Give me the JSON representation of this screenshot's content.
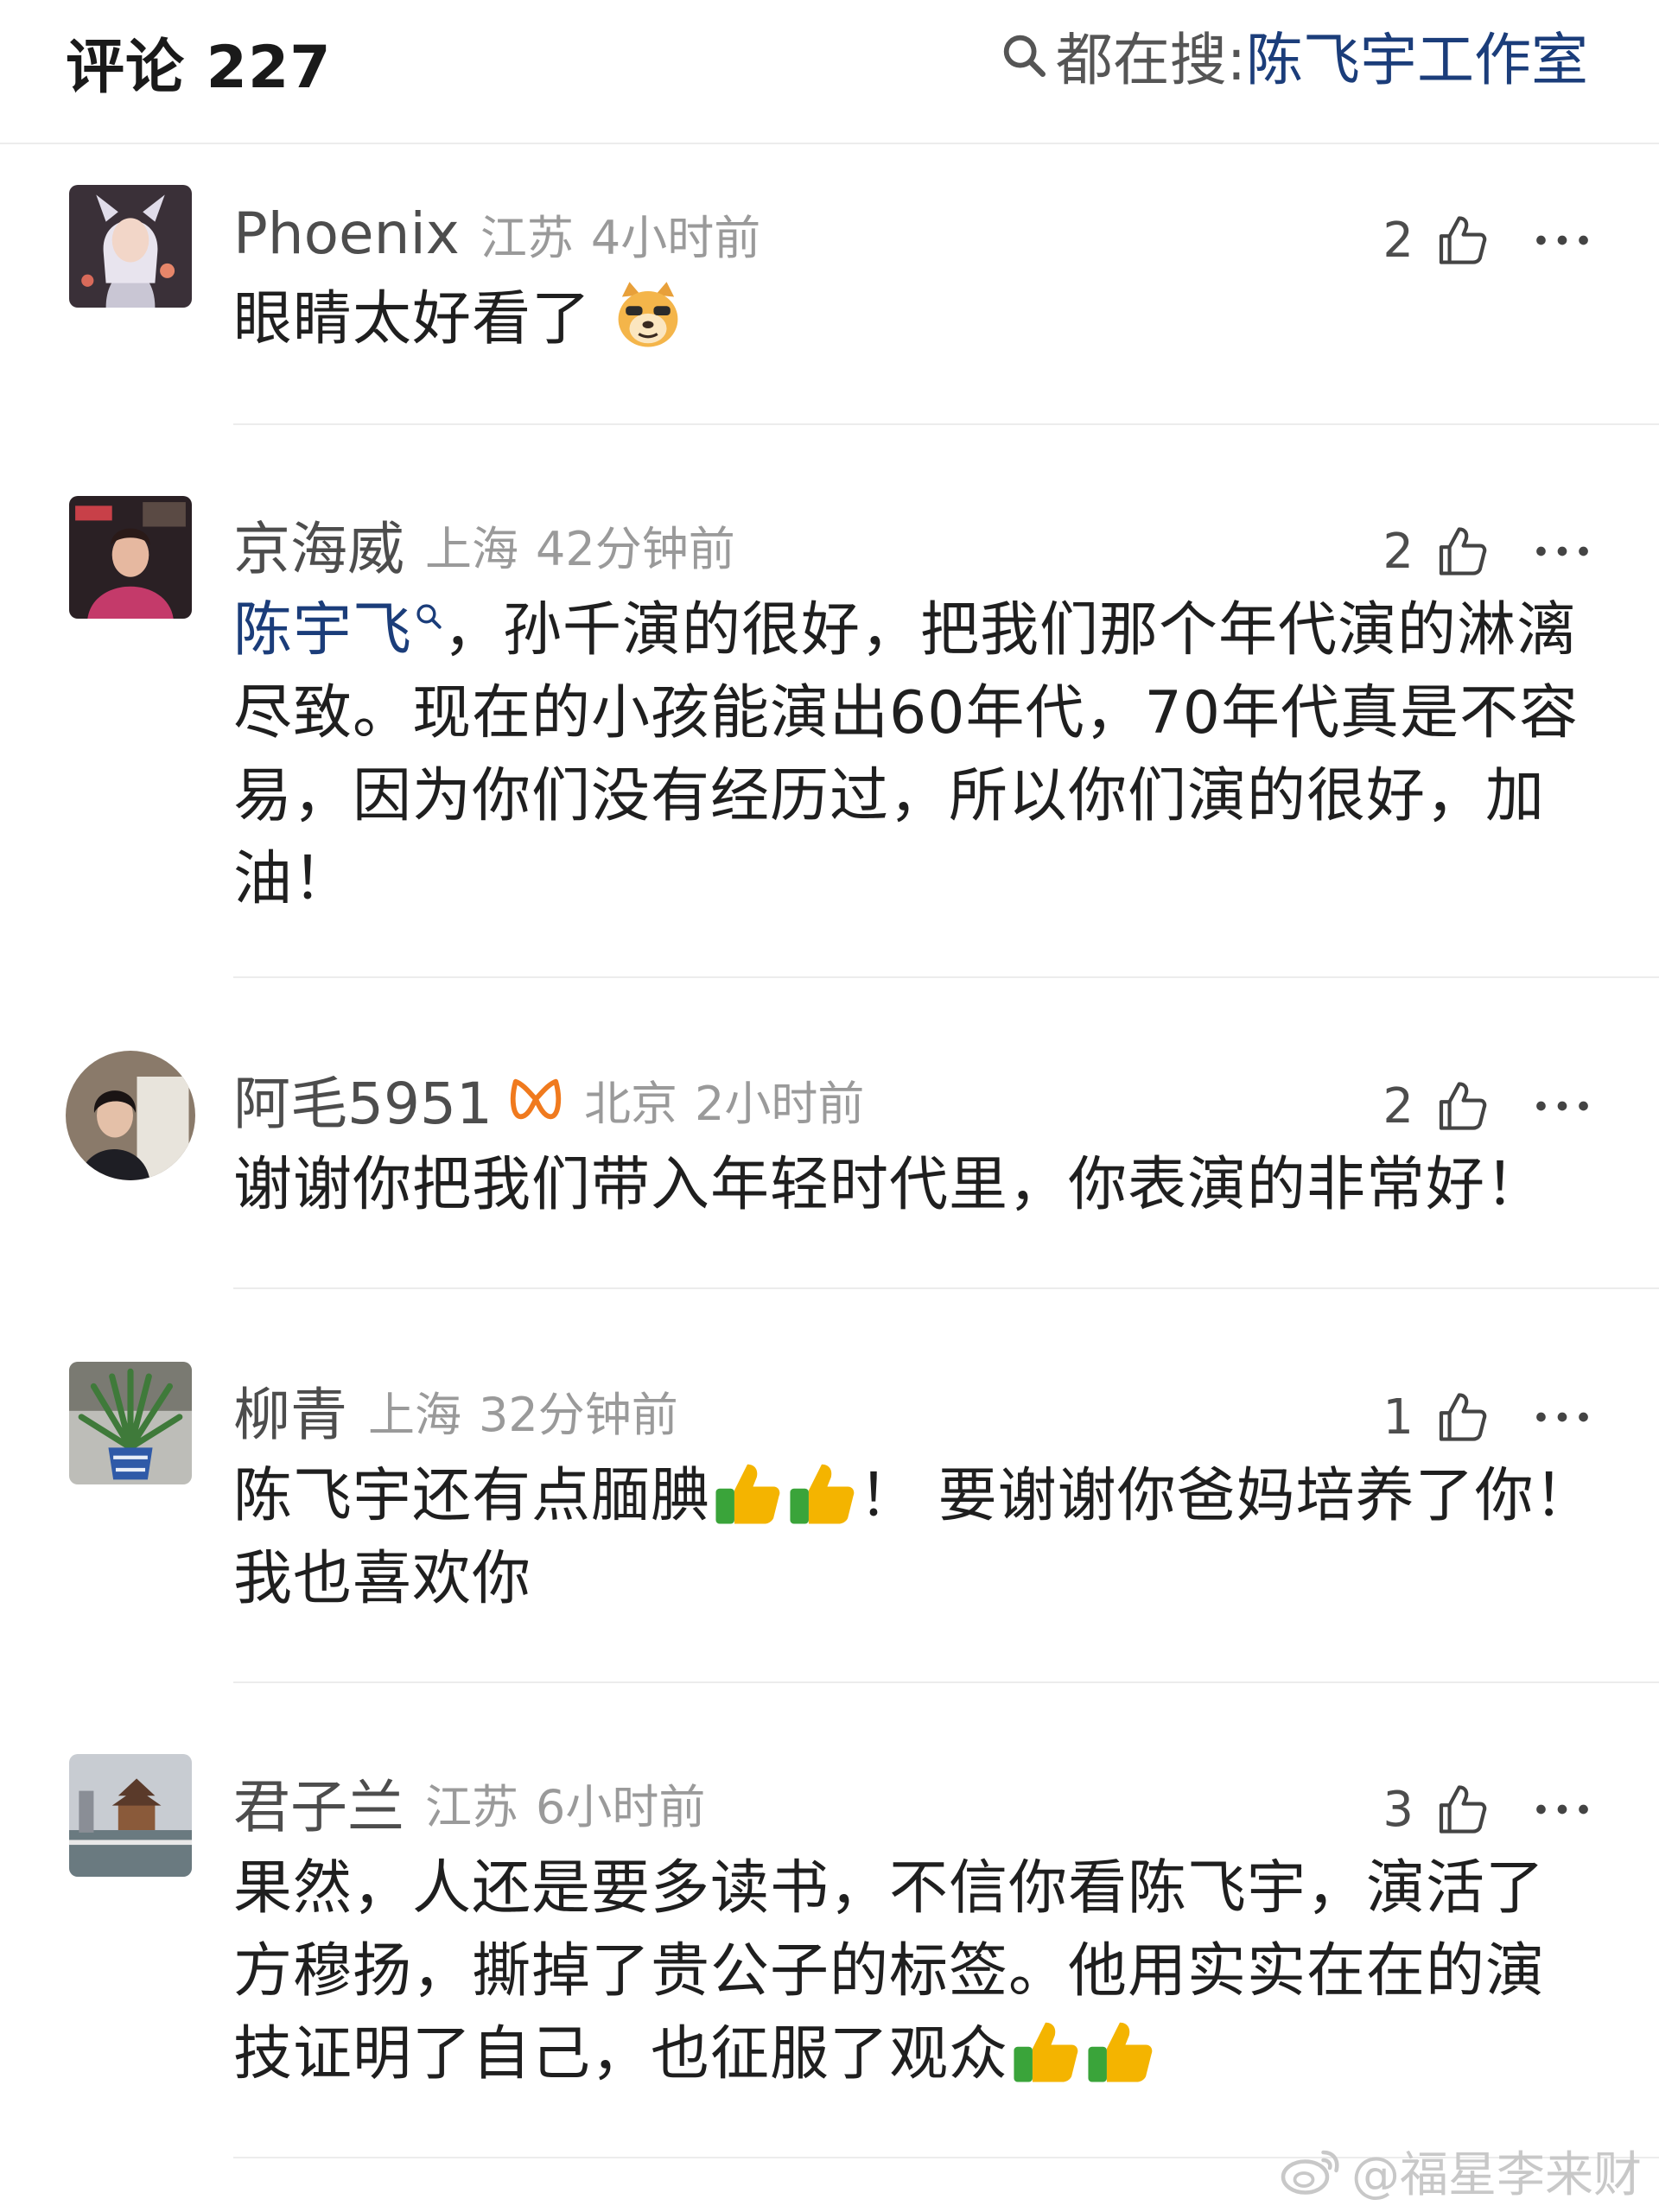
{
  "header": {
    "title": "评论 227",
    "search_label": "都在搜:",
    "search_term": "陈飞宇工作室"
  },
  "comments": [
    {
      "name": "Phoenix",
      "location": "江苏",
      "time": "4小时前",
      "likes": "2",
      "text": "眼睛太好看了",
      "emoji": "doge-emoji"
    },
    {
      "name": "京海威",
      "location": "上海",
      "time": "42分钟前",
      "likes": "2",
      "mention": "陈宇飞",
      "text": "，孙千演的很好，把我们那个年代演的淋漓尽致。现在的小孩能演出60年代，70年代真是不容易，因为你们没有经历过，所以你们演的很好，加油！"
    },
    {
      "name": "阿毛5951",
      "location": "北京",
      "time": "2小时前",
      "likes": "2",
      "text": "谢谢你把我们带入年轻时代里，你表演的非常好！"
    },
    {
      "name": "柳青",
      "location": "上海",
      "time": "32分钟前",
      "likes": "1",
      "text_before": "陈飞宇还有点腼腆",
      "text_after": "！ 要谢谢你爸妈培养了你！ 我也喜欢你"
    },
    {
      "name": "君子兰",
      "location": "江苏",
      "time": "6小时前",
      "likes": "3",
      "text": "果然，人还是要多读书，不信你看陈飞宇，演活了方穆扬，撕掉了贵公子的标签。他用实实在在的演技证明了自己，也征服了观众"
    }
  ],
  "watermark": "@福星李来财",
  "colors": {
    "link": "#1b3d7a",
    "meta": "#9a9a9a",
    "name": "#4d4d4d",
    "badge": "#f07a1e"
  }
}
